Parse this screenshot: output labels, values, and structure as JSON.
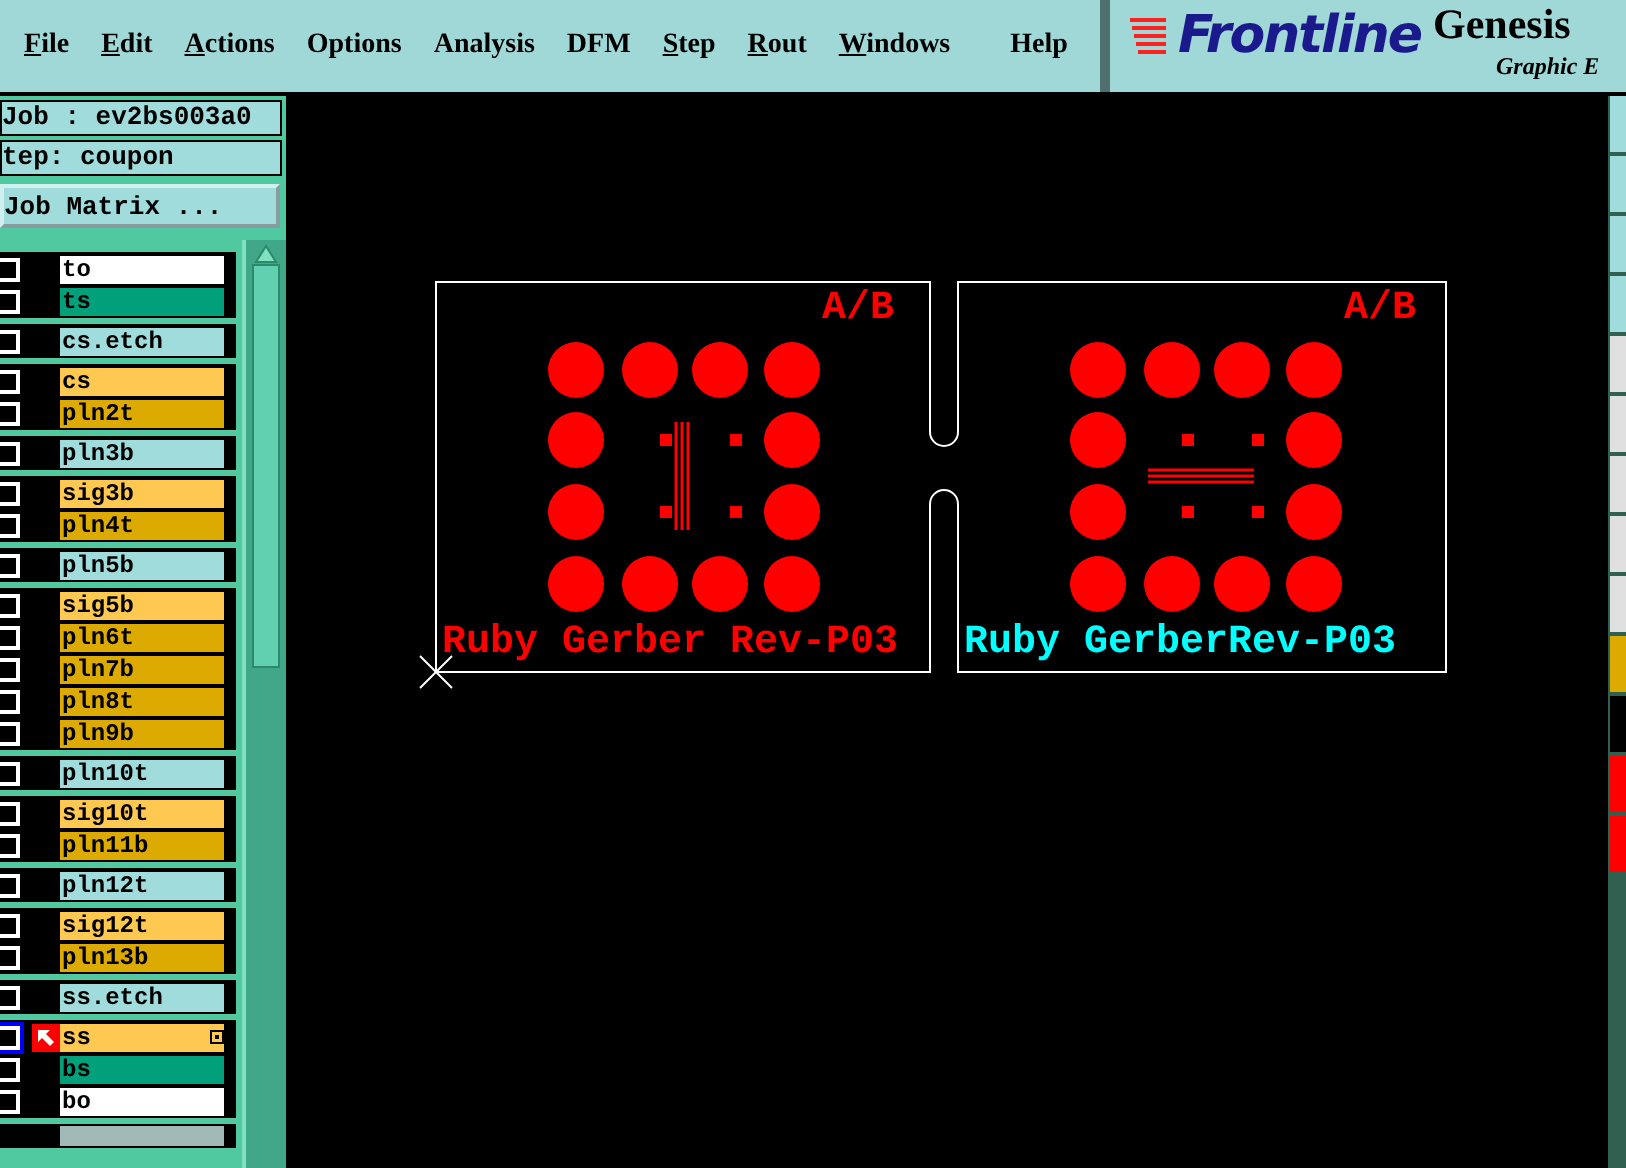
{
  "menu": [
    {
      "label": "File",
      "mnemonic": true
    },
    {
      "label": "Edit",
      "mnemonic": true
    },
    {
      "label": "Actions",
      "mnemonic": true
    },
    {
      "label": "Options",
      "mnemonic": false
    },
    {
      "label": "Analysis",
      "mnemonic": false
    },
    {
      "label": "DFM",
      "mnemonic": false
    },
    {
      "label": "Step",
      "mnemonic": true
    },
    {
      "label": "Rout",
      "mnemonic": true
    },
    {
      "label": "Windows",
      "mnemonic": true
    },
    {
      "label": "Help",
      "mnemonic": false
    }
  ],
  "logo": {
    "brand": "Frontline",
    "product": "Genesis",
    "subtitle": "Graphic E"
  },
  "job": "Job : ev2bs003a0",
  "step": "tep: coupon",
  "job_matrix_button": "Job Matrix ...",
  "layer_groups": [
    {
      "layers": [
        {
          "name": "to",
          "color": "#ffffff",
          "checked": false,
          "active": false
        },
        {
          "name": "ts",
          "color": "#00a07a",
          "checked": false,
          "active": false
        }
      ]
    },
    {
      "layers": [
        {
          "name": "cs.etch",
          "color": "#a0dcdc",
          "checked": false,
          "active": false
        }
      ]
    },
    {
      "layers": [
        {
          "name": "cs",
          "color": "#ffc850",
          "checked": false,
          "active": false
        },
        {
          "name": "pln2t",
          "color": "#dcaa00",
          "checked": false,
          "active": false
        }
      ]
    },
    {
      "layers": [
        {
          "name": "pln3b",
          "color": "#a0dcdc",
          "checked": false,
          "active": false
        }
      ]
    },
    {
      "layers": [
        {
          "name": "sig3b",
          "color": "#ffc850",
          "checked": false,
          "active": false
        },
        {
          "name": "pln4t",
          "color": "#dcaa00",
          "checked": false,
          "active": false
        }
      ]
    },
    {
      "layers": [
        {
          "name": "pln5b",
          "color": "#a0dcdc",
          "checked": false,
          "active": false
        }
      ]
    },
    {
      "layers": [
        {
          "name": "sig5b",
          "color": "#ffc850",
          "checked": false,
          "active": false
        },
        {
          "name": "pln6t",
          "color": "#dcaa00",
          "checked": false,
          "active": false
        },
        {
          "name": "pln7b",
          "color": "#dcaa00",
          "checked": false,
          "active": false
        },
        {
          "name": "pln8t",
          "color": "#dcaa00",
          "checked": false,
          "active": false
        },
        {
          "name": "pln9b",
          "color": "#dcaa00",
          "checked": false,
          "active": false
        }
      ]
    },
    {
      "layers": [
        {
          "name": "pln10t",
          "color": "#a0dcdc",
          "checked": false,
          "active": false
        }
      ]
    },
    {
      "layers": [
        {
          "name": "sig10t",
          "color": "#ffc850",
          "checked": false,
          "active": false
        },
        {
          "name": "pln11b",
          "color": "#dcaa00",
          "checked": false,
          "active": false
        }
      ]
    },
    {
      "layers": [
        {
          "name": "pln12t",
          "color": "#a0dcdc",
          "checked": false,
          "active": false
        }
      ]
    },
    {
      "layers": [
        {
          "name": "sig12t",
          "color": "#ffc850",
          "checked": false,
          "active": false
        },
        {
          "name": "pln13b",
          "color": "#dcaa00",
          "checked": false,
          "active": false
        }
      ]
    },
    {
      "layers": [
        {
          "name": "ss.etch",
          "color": "#a0dcdc",
          "checked": false,
          "active": false
        }
      ]
    },
    {
      "layers": [
        {
          "name": "ss",
          "color": "#ffc850",
          "checked": false,
          "active": true
        },
        {
          "name": "bs",
          "color": "#00a07a",
          "checked": false,
          "active": false
        },
        {
          "name": "bo",
          "color": "#ffffff",
          "checked": false,
          "active": false
        }
      ]
    }
  ],
  "boards": [
    {
      "marking": "A/B",
      "caption": "Ruby Gerber Rev-P03",
      "color": "#ff0000",
      "kind": "vertical"
    },
    {
      "marking": "A/B",
      "caption": "Ruby GerberRev-P03",
      "color": "#00ffff",
      "kind": "horizontal"
    }
  ]
}
